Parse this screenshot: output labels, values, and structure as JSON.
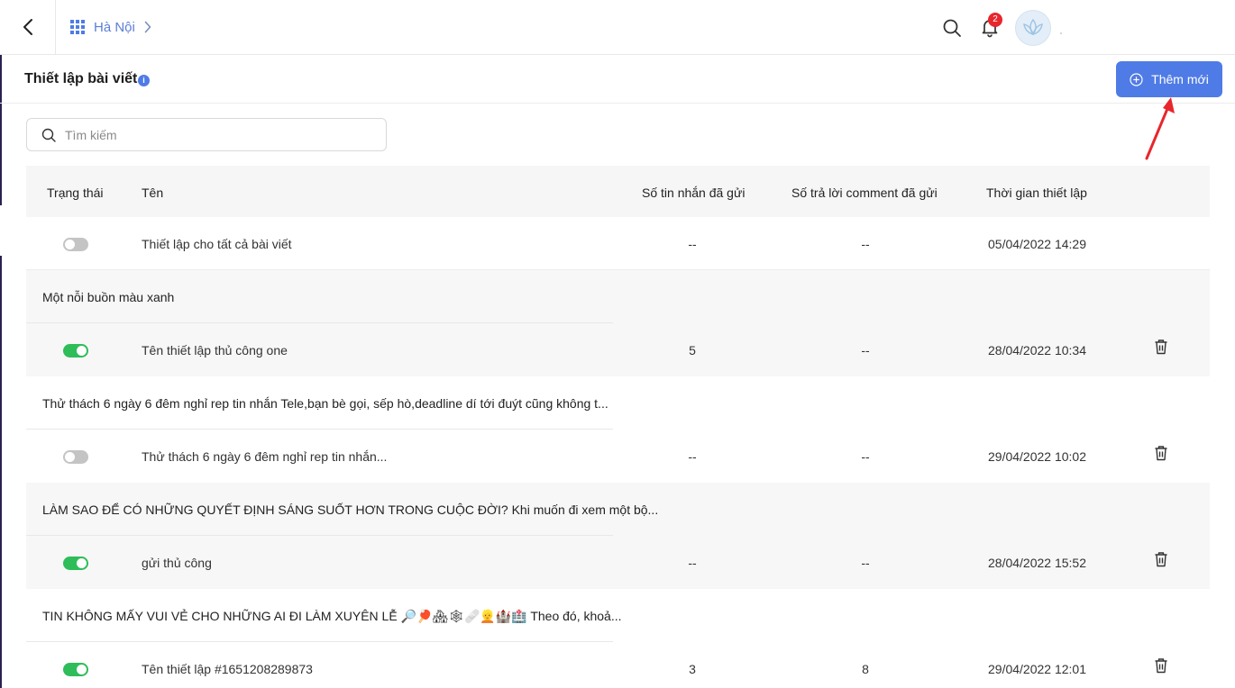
{
  "topbar": {
    "breadcrumb": "Hà Nội",
    "notification_count": "2"
  },
  "header": {
    "title": "Thiết lập bài viết",
    "info_symbol": "i",
    "add_button": "Thêm mới"
  },
  "search": {
    "placeholder": "Tìm kiếm"
  },
  "table": {
    "columns": {
      "status": "Trạng thái",
      "name": "Tên",
      "sent": "Số tin nhắn đã gửi",
      "replies": "Số trả lời comment đã gửi",
      "time": "Thời gian thiết lập"
    },
    "rows": [
      {
        "enabled": false,
        "name": "Thiết lập cho tất cả bài viết",
        "sent": "--",
        "replies": "--",
        "time": "05/04/2022 14:29"
      },
      {
        "group": "Một nỗi buồn màu xanh",
        "enabled": true,
        "name": "Tên thiết lập thủ công one",
        "sent": "5",
        "replies": "--",
        "time": "28/04/2022 10:34"
      },
      {
        "group": "Thử thách 6 ngày 6 đêm nghỉ rep tin nhắn Tele,bạn bè gọi, sếp hò,deadline dí tới đuýt cũng không t...",
        "enabled": false,
        "name": "Thử thách 6 ngày 6 đêm nghỉ rep tin nhắn...",
        "sent": "--",
        "replies": "--",
        "time": "29/04/2022 10:02"
      },
      {
        "group": "LÀM SAO ĐỂ CÓ NHỮNG QUYẾT ĐỊNH SÁNG SUỐT HƠN TRONG CUỘC ĐỜI? Khi muốn đi xem một bộ...",
        "enabled": true,
        "name": "gửi thủ công",
        "sent": "--",
        "replies": "--",
        "time": "28/04/2022 15:52"
      },
      {
        "group": "TIN KHÔNG MẤY VUI VẺ CHO NHỮNG AI ĐI LÀM XUYÊN LỄ 🔎🏓🏘🕸🩹👱🏰🏥 Theo đó, khoả...",
        "enabled": true,
        "name": "Tên thiết lập #1651208289873",
        "sent": "3",
        "replies": "8",
        "time": "29/04/2022 12:01"
      }
    ]
  },
  "colors": {
    "accent": "#4f7be6",
    "toggle_on": "#2ebd59",
    "toggle_off": "#c4c4c4",
    "badge": "#e8262d",
    "arrow": "#e8262d"
  }
}
